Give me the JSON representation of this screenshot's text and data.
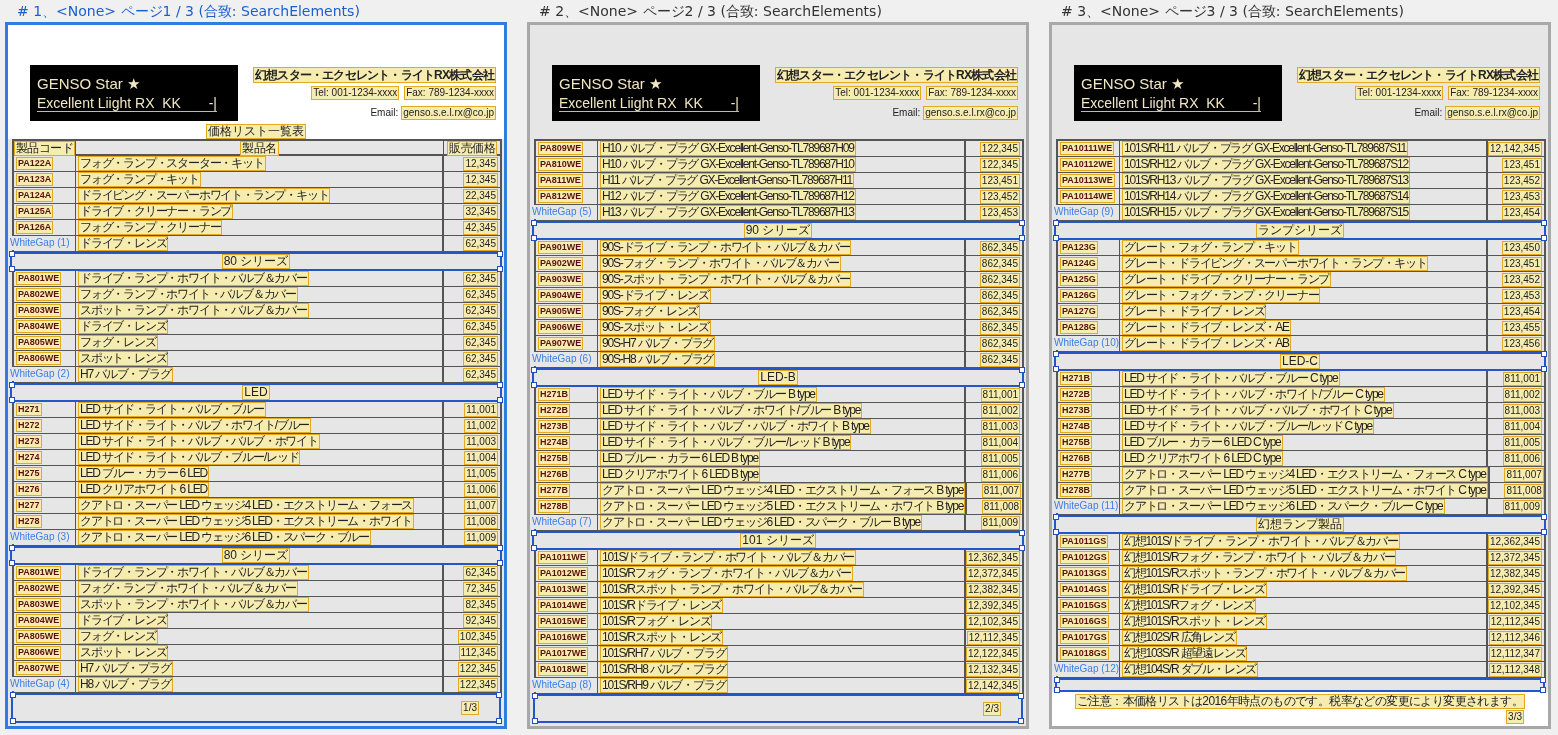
{
  "pages": [
    {
      "caption": "# 1、<None> ページ1 / 3 (合致: SearchElements)",
      "selected": true,
      "logo": {
        "title": "GENSO Star ★",
        "subtitle": "Excellent Liight RX  KK",
        "mark": "-|"
      },
      "company": "幻想スター・エクセレント・ライトRX株式会社",
      "tel": "Tel: 001-1234-xxxx",
      "fax": "Fax: 789-1234-xxxx",
      "email_label": "Email:",
      "email": "genso.s.e.l.rx@co.jp",
      "list_title": "価格リスト一覧表",
      "columns": [
        "製品コード",
        "製品名",
        "販売価格"
      ],
      "blocks": [
        {
          "rows": [
            {
              "code": "PA122A",
              "name": "フォグ・ランプ・スターター・キット",
              "price": "12,345"
            },
            {
              "code": "PA123A",
              "name": "フォグ・ランプ・キット",
              "price": "12,345"
            },
            {
              "code": "PA124A",
              "name": "ドライビング・スーパーホワイト・ランプ・キット",
              "price": "22,345"
            },
            {
              "code": "PA125A",
              "name": "ドライブ・クリーナー・ランプ",
              "price": "32,345"
            },
            {
              "code": "PA126A",
              "name": "フォグ・ランプ・クリーナー",
              "price": "42,345"
            },
            {
              "name": "ドライブ・レンズ",
              "price": "62,345"
            }
          ],
          "gap_label": "WhiteGap (1)",
          "section": "80 シリーズ"
        },
        {
          "rows": [
            {
              "code": "PA801WE",
              "name": "ドライブ・ランプ・ホワイト・バルブ＆カバー",
              "price": "62,345"
            },
            {
              "code": "PA802WE",
              "name": "フォグ・ランプ・ホワイト・バルブ＆カバー",
              "price": "62,345"
            },
            {
              "code": "PA803WE",
              "name": "スポット・ランプ・ホワイト・バルブ＆カバー",
              "price": "62,345"
            },
            {
              "code": "PA804WE",
              "name": "ドライブ・レンズ",
              "price": "62,345"
            },
            {
              "code": "PA805WE",
              "name": "フォグ・レンズ",
              "price": "62,345"
            },
            {
              "code": "PA806WE",
              "name": "スポット・レンズ",
              "price": "62,345"
            },
            {
              "name": "H7 バルブ・プラグ",
              "price": "62,345"
            }
          ],
          "gap_label": "WhiteGap (2)",
          "section": "LED"
        },
        {
          "rows": [
            {
              "code": "H271",
              "name": "LED サイド・ライト・バルブ・ブルー",
              "price": "11,001"
            },
            {
              "code": "H272",
              "name": "LED サイド・ライト・バルブ・ホワイト/ブルー",
              "price": "11,002"
            },
            {
              "code": "H273",
              "name": "LED サイド・ライト・バルブ・バルブ・ホワイト",
              "price": "11,003"
            },
            {
              "code": "H274",
              "name": "LED サイド・ライト・バルブ・ブルー/レッド",
              "price": "11,004"
            },
            {
              "code": "H275",
              "name": "LED ブルー・カラー 6 LED",
              "price": "11,005"
            },
            {
              "code": "H276",
              "name": "LED クリアホワイト 6 LED",
              "price": "11,006"
            },
            {
              "code": "H277",
              "name": "クアトロ・スーパー LED ウェッジ4 LED・エクストリーム・フォース",
              "price": "11,007"
            },
            {
              "code": "H278",
              "name": "クアトロ・スーパー LED ウェッジ5 LED・エクストリーム・ホワイト",
              "price": "11,008"
            },
            {
              "name": "クアトロ・スーパー LED ウェッジ6 LED・スパーク・ブルー",
              "price": "11,009"
            }
          ],
          "gap_label": "WhiteGap (3)",
          "section": "80 シリーズ"
        },
        {
          "rows": [
            {
              "code": "PA801WE",
              "name": "ドライブ・ランプ・ホワイト・バルブ＆カバー",
              "price": "62,345"
            },
            {
              "code": "PA802WE",
              "name": "フォグ・ランプ・ホワイト・バルブ＆カバー",
              "price": "72,345"
            },
            {
              "code": "PA803WE",
              "name": "スポット・ランプ・ホワイト・バルブ＆カバー",
              "price": "82,345"
            },
            {
              "code": "PA804WE",
              "name": "ドライブ・レンズ",
              "price": "92,345"
            },
            {
              "code": "PA805WE",
              "name": "フォグ・レンズ",
              "price": "102,345"
            },
            {
              "code": "PA806WE",
              "name": "スポット・レンズ",
              "price": "112,345"
            },
            {
              "code": "PA807WE",
              "name": "H7 バルブ・プラグ",
              "price": "122,345"
            },
            {
              "name": "H8 バルブ・プラグ",
              "price": "122,345"
            }
          ],
          "gap_label": "WhiteGap (4)"
        }
      ],
      "footer": {
        "page_number": "1/3"
      }
    },
    {
      "caption": "# 2、<None> ページ2 / 3 (合致: SearchElements)",
      "selected": false,
      "logo": {
        "title": "GENSO Star ★",
        "subtitle": "Excellent Liight RX  KK",
        "mark": "-|"
      },
      "company": "幻想スター・エクセレント・ライトRX株式会社",
      "tel": "Tel: 001-1234-xxxx",
      "fax": "Fax: 789-1234-xxxx",
      "email_label": "Email:",
      "email": "genso.s.e.l.rx@co.jp",
      "blocks": [
        {
          "rows": [
            {
              "code": "PA809WE",
              "name": "H10 バルブ・プラグ GX-Excellent-Genso-TL789687H09",
              "price": "122,345"
            },
            {
              "code": "PA810WE",
              "name": "H10 バルブ・プラグ GX-Excellent-Genso-TL789687H10",
              "price": "122,345"
            },
            {
              "code": "PA811WE",
              "name": "H11 バルブ・プラグ GX-Excellent-Genso-TL789687H11",
              "price": "123,451"
            },
            {
              "code": "PA812WE",
              "name": "H12 バルブ・プラグ GX-Excellent-Genso-TL789687H12",
              "price": "123,452"
            },
            {
              "name": "H13 バルブ・プラグ GX-Excellent-Genso-TL789687H13",
              "price": "123,453"
            }
          ],
          "gap_label": "WhiteGap (5)",
          "section": "90 シリーズ"
        },
        {
          "rows": [
            {
              "code": "PA901WE",
              "name": "90S-ドライブ・ランプ・ホワイト・バルブ＆カバー",
              "price": "862,345"
            },
            {
              "code": "PA902WE",
              "name": "90S-フォグ・ランプ・ホワイト・バルブ＆カバー",
              "price": "862,345"
            },
            {
              "code": "PA903WE",
              "name": "90S-スポット・ランプ・ホワイト・バルブ＆カバー",
              "price": "862,345"
            },
            {
              "code": "PA904WE",
              "name": "90S-ドライブ・レンズ",
              "price": "862,345"
            },
            {
              "code": "PA905WE",
              "name": "90S-フォグ・レンズ",
              "price": "862,345"
            },
            {
              "code": "PA906WE",
              "name": "90S-スポット・レンズ",
              "price": "862,345"
            },
            {
              "code": "PA907WE",
              "name": "90S-H7 バルブ・プラグ",
              "price": "862,345"
            },
            {
              "name": "90S-H8 バルブ・プラグ",
              "price": "862,345"
            }
          ],
          "gap_label": "WhiteGap (6)",
          "section": "LED-B"
        },
        {
          "rows": [
            {
              "code": "H271B",
              "name": "LED サイド・ライト・バルブ・ブルー B type",
              "price": "811,001"
            },
            {
              "code": "H272B",
              "name": "LED サイド・ライト・バルブ・ホワイト/ブルー B type",
              "price": "811,002"
            },
            {
              "code": "H273B",
              "name": "LED サイド・ライト・バルブ・バルブ・ホワイト B type",
              "price": "811,003"
            },
            {
              "code": "H274B",
              "name": "LED サイド・ライト・バルブ・ブルー/レッド B type",
              "price": "811,004"
            },
            {
              "code": "H275B",
              "name": "LED ブルー・カラー 6 LED B type",
              "price": "811,005"
            },
            {
              "code": "H276B",
              "name": "LED クリアホワイト 6 LED B type",
              "price": "811,006"
            },
            {
              "code": "H277B",
              "name": "クアトロ・スーパー LED ウェッジ4 LED・エクストリーム・フォース B type",
              "price": "811,007"
            },
            {
              "code": "H278B",
              "name": "クアトロ・スーパー LED ウェッジ5 LED・エクストリーム・ホワイト B type",
              "price": "811,008"
            },
            {
              "name": "クアトロ・スーパー LED ウェッジ6 LED・スパーク・ブルー B type",
              "price": "811,009"
            }
          ],
          "gap_label": "WhiteGap (7)",
          "section": "101 シリーズ"
        },
        {
          "rows": [
            {
              "code": "PA1011WE",
              "name": "101S/ドライブ・ランプ・ホワイト・バルブ＆カバー",
              "price": "12,362,345"
            },
            {
              "code": "PA1012WE",
              "name": "101S/Rフォグ・ランプ・ホワイト・バルブ＆カバー",
              "price": "12,372,345"
            },
            {
              "code": "PA1013WE",
              "name": "101S/Rスポット・ランプ・ホワイト・バルブ＆カバー",
              "price": "12,382,345"
            },
            {
              "code": "PA1014WE",
              "name": "101S/Rドライブ・レンズ",
              "price": "12,392,345"
            },
            {
              "code": "PA1015WE",
              "name": "101S/Rフォグ・レンズ",
              "price": "12,102,345"
            },
            {
              "code": "PA1016WE",
              "name": "101S/Rスポット・レンズ",
              "price": "12,112,345"
            },
            {
              "code": "PA1017WE",
              "name": "101S/RH7 バルブ・プラグ",
              "price": "12,122,345"
            },
            {
              "code": "PA1018WE",
              "name": "101S/RH8 バルブ・プラグ",
              "price": "12,132,345"
            },
            {
              "name": "101S/RH9 バルブ・プラグ",
              "price": "12,142,345"
            }
          ],
          "gap_label": "WhiteGap (8)"
        }
      ],
      "footer": {
        "page_number": "2/3"
      }
    },
    {
      "caption": "# 3、<None> ページ3 / 3 (合致: SearchElements)",
      "selected": false,
      "logo": {
        "title": "GENSO Star ★",
        "subtitle": "Excellent Liight RX  KK",
        "mark": "-|"
      },
      "company": "幻想スター・エクセレント・ライトRX株式会社",
      "tel": "Tel: 001-1234-xxxx",
      "fax": "Fax: 789-1234-xxxx",
      "email_label": "Email:",
      "email": "genso.s.e.l.rx@co.jp",
      "blocks": [
        {
          "rows": [
            {
              "code": "PA10111WE",
              "name": "101S/RH11 バルブ・プラグ GX-Excellent-Genso-TL789687S11",
              "price": "12,142,345"
            },
            {
              "code": "PA10112WE",
              "name": "101S/RH12 バルブ・プラグ GX-Excellent-Genso-TL789687S12",
              "price": "123,451"
            },
            {
              "code": "PA10113WE",
              "name": "101S/RH13 バルブ・プラグ GX-Excellent-Genso-TL789687S13",
              "price": "123,452"
            },
            {
              "code": "PA10114WE",
              "name": "101S/RH14 バルブ・プラグ GX-Excellent-Genso-TL789687S14",
              "price": "123,453"
            },
            {
              "name": "101S/RH15 バルブ・プラグ GX-Excellent-Genso-TL789687S15",
              "price": "123,454"
            }
          ],
          "gap_label": "WhiteGap (9)",
          "section": "ランプシリーズ"
        },
        {
          "rows": [
            {
              "code": "PA123G",
              "name": "グレート・フォグ・ランプ・キット",
              "price": "123,450"
            },
            {
              "code": "PA124G",
              "name": "グレート・ドライビング・スーパーホワイト・ランプ・キット",
              "price": "123,451"
            },
            {
              "code": "PA125G",
              "name": "グレート・ドライブ・クリーナー・ランプ",
              "price": "123,452"
            },
            {
              "code": "PA126G",
              "name": "グレート・フォグ・ランプ・クリーナー",
              "price": "123,453"
            },
            {
              "code": "PA127G",
              "name": "グレート・ドライブ・レンズ",
              "price": "123,454"
            },
            {
              "code": "PA128G",
              "name": "グレート・ドライブ・レンズ・AE",
              "price": "123,455"
            },
            {
              "name": "グレート・ドライブ・レンズ・AB",
              "price": "123,456"
            }
          ],
          "gap_label": "WhiteGap (10)",
          "section": "LED-C"
        },
        {
          "rows": [
            {
              "code": "H271B",
              "name": "LED サイド・ライト・バルブ・ブルー C type",
              "price": "811,001"
            },
            {
              "code": "H272B",
              "name": "LED サイド・ライト・バルブ・ホワイト/ブルー C type",
              "price": "811,002"
            },
            {
              "code": "H273B",
              "name": "LED サイド・ライト・バルブ・バルブ・ホワイト C type",
              "price": "811,003"
            },
            {
              "code": "H274B",
              "name": "LED サイド・ライト・バルブ・ブルー/レッド C type",
              "price": "811,004"
            },
            {
              "code": "H275B",
              "name": "LED ブルー・カラー 6 LED C type",
              "price": "811,005"
            },
            {
              "code": "H276B",
              "name": "LED クリアホワイト 6 LED C type",
              "price": "811,006"
            },
            {
              "code": "H277B",
              "name": "クアトロ・スーパー LED ウェッジ4 LED・エクストリーム・フォース C type",
              "price": "811,007"
            },
            {
              "code": "H278B",
              "name": "クアトロ・スーパー LED ウェッジ5 LED・エクストリーム・ホワイト C type",
              "price": "811,008"
            },
            {
              "name": "クアトロ・スーパー LED ウェッジ6 LED・スパーク・ブルー C type",
              "price": "811,009"
            }
          ],
          "gap_label": "WhiteGap (11)",
          "section": "幻想ランプ製品"
        },
        {
          "rows": [
            {
              "code": "PA1011GS",
              "name": "幻想101S/ドライブ・ランプ・ホワイト・バルブ＆カバー",
              "price": "12,362,345"
            },
            {
              "code": "PA1012GS",
              "name": "幻想101S/Rフォグ・ランプ・ホワイト・バルブ＆カバー",
              "price": "12,372,345"
            },
            {
              "code": "PA1013GS",
              "name": "幻想101S/Rスポット・ランプ・ホワイト・バルブ＆カバー",
              "price": "12,382,345"
            },
            {
              "code": "PA1014GS",
              "name": "幻想101S/Rドライブ・レンズ",
              "price": "12,392,345"
            },
            {
              "code": "PA1015GS",
              "name": "幻想101S/Rフォグ・レンズ",
              "price": "12,102,345"
            },
            {
              "code": "PA1016GS",
              "name": "幻想101S/Rスポット・レンズ",
              "price": "12,112,345"
            },
            {
              "code": "PA1017GS",
              "name": "幻想102S/R 広角レンズ",
              "price": "12,112,346"
            },
            {
              "code": "PA1018GS",
              "name": "幻想103S/R 超望遠レンズ",
              "price": "12,112,347"
            },
            {
              "name": "幻想104S/R ダブル・レンズ",
              "price": "12,112,348"
            }
          ],
          "gap_label": "WhiteGap (12)"
        }
      ],
      "footer": {
        "note": "ご注意：本価格リストは2016年時点のものです。税率などの変更により変更されます。",
        "page_number": "3/3"
      }
    }
  ]
}
